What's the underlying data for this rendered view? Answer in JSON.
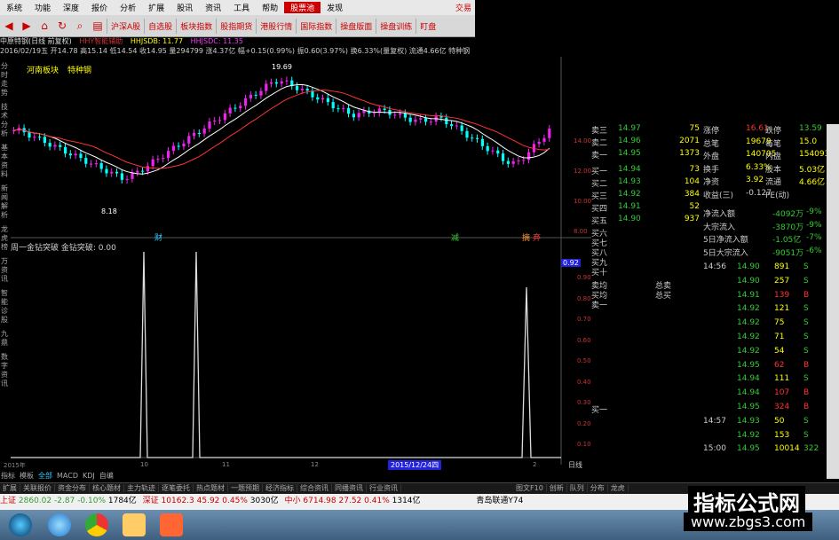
{
  "menubar": {
    "items": [
      "系统",
      "功能",
      "深度",
      "报价",
      "分析",
      "扩展",
      "股讯",
      "资讯",
      "工具",
      "帮助",
      "股票池",
      "发现"
    ],
    "active": "股票池",
    "right": "交易"
  },
  "toolbar": {
    "buttons": [
      "沪深A股",
      "自选股",
      "板块指数",
      "股指期货",
      "港股行情",
      "国际指数",
      "操盘版面",
      "操盘训练",
      "盯盘"
    ]
  },
  "info": {
    "stock": "中原特钢(日线 前复权)",
    "hhy": "HHY智能辅助",
    "hhjsdb": "HHJSDB: 11.77",
    "hhjsdc": "HHJSDC: 11.35"
  },
  "quote": {
    "line": "2016/02/19五 开14.78 高15.14 低14.54 收14.95 量294799 涨4.37亿 幅+0.15(0.99%) 振0.60(3.97%) 换6.33%(量复权) 流通4.66亿 特种钢"
  },
  "tags": {
    "board": "河南板块",
    "industry": "特种钢",
    "peak": "19.69",
    "low": "8.18",
    "m1": "财",
    "m2": "减",
    "m3": "摘",
    "m4": "弃"
  },
  "sidetabs": [
    "分时走势",
    "技术分析",
    "基本资料",
    "新闻解析",
    "龙虎榜",
    "万资讯",
    "智能诊股",
    "九鼎",
    "数字资讯"
  ],
  "indicator": {
    "title": "周一金钻突破 金钻突破: 0.00",
    "value_label": "0.92",
    "peaks": [
      0,
      1.0,
      0,
      1.0,
      0,
      0,
      0,
      0,
      0,
      0.83,
      0
    ]
  },
  "axis": {
    "price_ticks": [
      "14.00",
      "12.00",
      "10.00",
      "8.00"
    ],
    "ind_ticks": [
      "0.90",
      "0.80",
      "0.70",
      "0.60",
      "0.50",
      "0.40",
      "0.30",
      "0.20",
      "0.10"
    ],
    "dates": [
      "2015年",
      "10",
      "11",
      "12",
      "1",
      "2"
    ],
    "cursor_date": "2015/12/24四",
    "period": "日线"
  },
  "orderbook": {
    "asks": [
      {
        "label": "卖三",
        "price": "14.97",
        "vol": "75"
      },
      {
        "label": "卖二",
        "price": "14.96",
        "vol": "2071"
      },
      {
        "label": "卖一",
        "price": "14.95",
        "vol": "1373"
      }
    ],
    "bids": [
      {
        "label": "买一",
        "price": "14.94",
        "vol": "73"
      },
      {
        "label": "买二",
        "price": "14.93",
        "vol": "104"
      },
      {
        "label": "买三",
        "price": "14.92",
        "vol": "384"
      },
      {
        "label": "买四",
        "price": "14.91",
        "vol": "52"
      },
      {
        "label": "买五",
        "price": "14.90",
        "vol": "937"
      }
    ],
    "extra": [
      "买六",
      "买七",
      "买八",
      "买九",
      "买十"
    ],
    "sum": [
      "卖均",
      "买均",
      "卖一"
    ],
    "totals": [
      "总卖",
      "总买"
    ],
    "bottom": "买一"
  },
  "stats": [
    {
      "k1": "涨停",
      "v1": "16.61",
      "k2": "跌停",
      "v2": "13.59"
    },
    {
      "k1": "总笔",
      "v1": "19679",
      "k2": "每笔",
      "v2": "15.0"
    },
    {
      "k1": "外盘",
      "v1": "140705",
      "k2": "内盘",
      "v2": "154093"
    },
    {
      "k1": "换手",
      "v1": "6.33%",
      "k2": "股本",
      "v2": "5.03亿"
    },
    {
      "k1": "净资",
      "v1": "3.92",
      "k2": "流通",
      "v2": "4.66亿"
    },
    {
      "k1": "收益(三)",
      "v1": "-0.127",
      "k2": "PE(动)",
      "v2": ""
    }
  ],
  "flows": [
    {
      "k": "净流入额",
      "v": "-4092万",
      "p": "-9%"
    },
    {
      "k": "大宗流入",
      "v": "-3870万",
      "p": "-9%"
    },
    {
      "k": "5日净流入额",
      "v": "-1.05亿",
      "p": "-7%"
    },
    {
      "k": "5日大宗流入",
      "v": "-9051万",
      "p": "-6%"
    }
  ],
  "ticks": [
    {
      "t": "14:56",
      "p": "14.90",
      "v": "891",
      "s": "S"
    },
    {
      "t": "",
      "p": "14.90",
      "v": "257",
      "s": "S"
    },
    {
      "t": "",
      "p": "14.91",
      "v": "139",
      "s": "B"
    },
    {
      "t": "",
      "p": "14.92",
      "v": "121",
      "s": "S"
    },
    {
      "t": "",
      "p": "14.92",
      "v": "75",
      "s": "S"
    },
    {
      "t": "",
      "p": "14.92",
      "v": "71",
      "s": "S"
    },
    {
      "t": "",
      "p": "14.92",
      "v": "54",
      "s": "S"
    },
    {
      "t": "",
      "p": "14.95",
      "v": "62",
      "s": "B"
    },
    {
      "t": "",
      "p": "14.94",
      "v": "111",
      "s": "S"
    },
    {
      "t": "",
      "p": "14.94",
      "v": "107",
      "s": "B"
    },
    {
      "t": "",
      "p": "14.95",
      "v": "324",
      "s": "B"
    },
    {
      "t": "14:57",
      "p": "14.93",
      "v": "50",
      "s": "S"
    },
    {
      "t": "",
      "p": "14.92",
      "v": "153",
      "s": "S"
    },
    {
      "t": "15:00",
      "p": "14.95",
      "v": "10014",
      "s": "322"
    }
  ],
  "bottombar": [
    "扩展",
    "关联报价",
    "资金分布",
    "核心题材",
    "主力轨迹",
    "逐笔委托",
    "热点题材",
    "一题预期",
    "经济指标",
    "综合资讯",
    "同播资讯",
    "行业资讯"
  ],
  "bottomright": [
    "图文F10",
    "创新",
    "队列",
    "分布",
    "龙虎"
  ],
  "lowertabs": [
    "指标",
    "模板",
    "全部",
    "MACD",
    "KDJ",
    "自编"
  ],
  "indexbar": {
    "sh_label": "上证",
    "sh": "2860.02",
    "sh_chg": "-2.87",
    "sh_pct": "-0.10%",
    "sh_amt": "1784亿",
    "sz_label": "深证",
    "sz": "10162.3",
    "sz_chg": "45.92",
    "sz_pct": "0.45%",
    "sz_amt": "3030亿",
    "zx_label": "中小",
    "zx": "6714.98",
    "zx_chg": "27.52",
    "zx_pct": "0.41%",
    "zx_amt": "1314亿",
    "conn": "青岛联通Y74"
  },
  "watermark": {
    "title": "指标公式网",
    "url": "www.zbgs3.com"
  },
  "colors": {
    "up": "#ff3333",
    "down": "#33cc33",
    "yellow": "#ffff00",
    "cyan": "#00ffff",
    "magenta": "#ee22ee"
  }
}
